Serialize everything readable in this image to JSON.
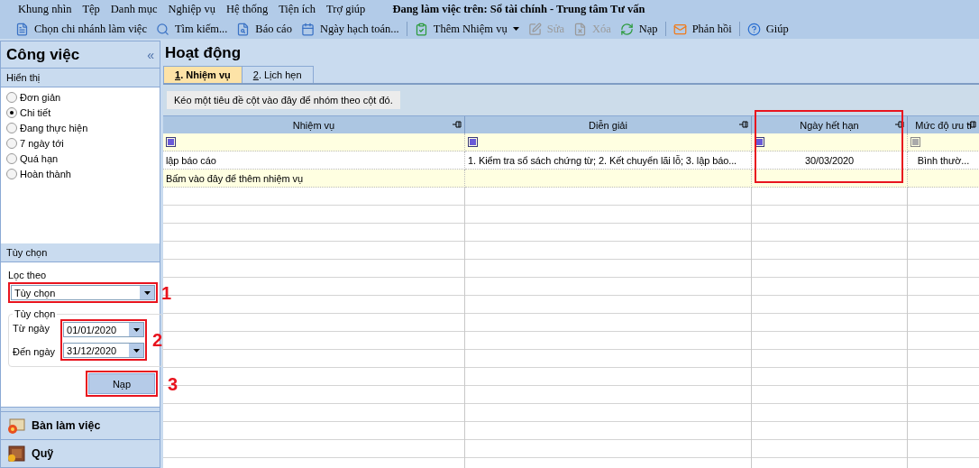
{
  "menu": [
    "Khung nhìn",
    "Tệp",
    "Danh mục",
    "Nghiệp vụ",
    "Hệ thống",
    "Tiện ích",
    "Trợ giúp"
  ],
  "status": {
    "label": "Đang làm việc trên:",
    "value": "Sổ tài chính - Trung tâm Tư vấn"
  },
  "toolbar": [
    [
      {
        "label": "Chọn chi nhánh làm việc",
        "disabled": false,
        "dropdown": false
      },
      {
        "label": "Tìm kiếm...",
        "disabled": false,
        "dropdown": false
      },
      {
        "label": "Báo cáo",
        "disabled": false,
        "dropdown": false
      },
      {
        "label": "Ngày hạch toán...",
        "disabled": false,
        "dropdown": false
      }
    ],
    [
      {
        "label": "Thêm Nhiệm vụ",
        "disabled": false,
        "dropdown": true
      },
      {
        "label": "Sửa",
        "disabled": true,
        "dropdown": false
      },
      {
        "label": "Xóa",
        "disabled": true,
        "dropdown": false
      },
      {
        "label": "Nạp",
        "disabled": false,
        "dropdown": false
      }
    ],
    [
      {
        "label": "Phản hồi",
        "disabled": false,
        "dropdown": false
      }
    ],
    [
      {
        "label": "Giúp",
        "disabled": false,
        "dropdown": false
      }
    ]
  ],
  "sidebar": {
    "title": "Công việc",
    "collapse": "«",
    "display": {
      "title": "Hiển thị",
      "options": [
        {
          "label": "Đơn giản",
          "selected": false
        },
        {
          "label": "Chi tiết",
          "selected": true
        },
        {
          "label": "Đang thực hiện",
          "selected": false
        },
        {
          "label": "7 ngày tới",
          "selected": false
        },
        {
          "label": "Quá hạn",
          "selected": false
        },
        {
          "label": "Hoàn thành",
          "selected": false
        }
      ]
    },
    "options": {
      "title": "Tùy chọn",
      "filter": {
        "label": "Lọc theo",
        "value": "Tùy chọn",
        "callout": "1"
      },
      "range": {
        "legend": "Tùy chọn",
        "callout": "2",
        "fields": [
          {
            "label": "Từ ngày",
            "value": "01/01/2020"
          },
          {
            "label": "Đến ngày",
            "value": "31/12/2020"
          }
        ]
      },
      "reload": {
        "label": "Nạp",
        "callout": "3"
      }
    },
    "nav": [
      {
        "label": "Bàn làm việc"
      },
      {
        "label": "Quỹ"
      }
    ]
  },
  "main": {
    "title": "Hoạt động",
    "tabs": [
      {
        "label": "1. Nhiệm vụ",
        "selected": true
      },
      {
        "label": "2. Lịch hẹn",
        "selected": false
      }
    ],
    "group_hint": "Kéo một tiêu đề cột vào đây để nhóm theo cột đó.",
    "columns": [
      {
        "title": "Nhiệm vụ",
        "highlighted": false,
        "filter_enabled": true
      },
      {
        "title": "Diễn giải",
        "highlighted": false,
        "filter_enabled": true
      },
      {
        "title": "Ngày hết hạn",
        "highlighted": true,
        "filter_enabled": true
      },
      {
        "title": "Mức độ ưu ti",
        "highlighted": false,
        "filter_enabled": false
      }
    ],
    "rows": [
      [
        "lập báo cáo",
        "1. Kiểm tra sổ sách chứng từ; 2. Kết chuyển lãi lỗ; 3. lập báo...",
        "30/03/2020",
        "Bình thườ..."
      ]
    ],
    "new_row_prompt": "Bấm vào đây để thêm nhiệm vụ"
  }
}
